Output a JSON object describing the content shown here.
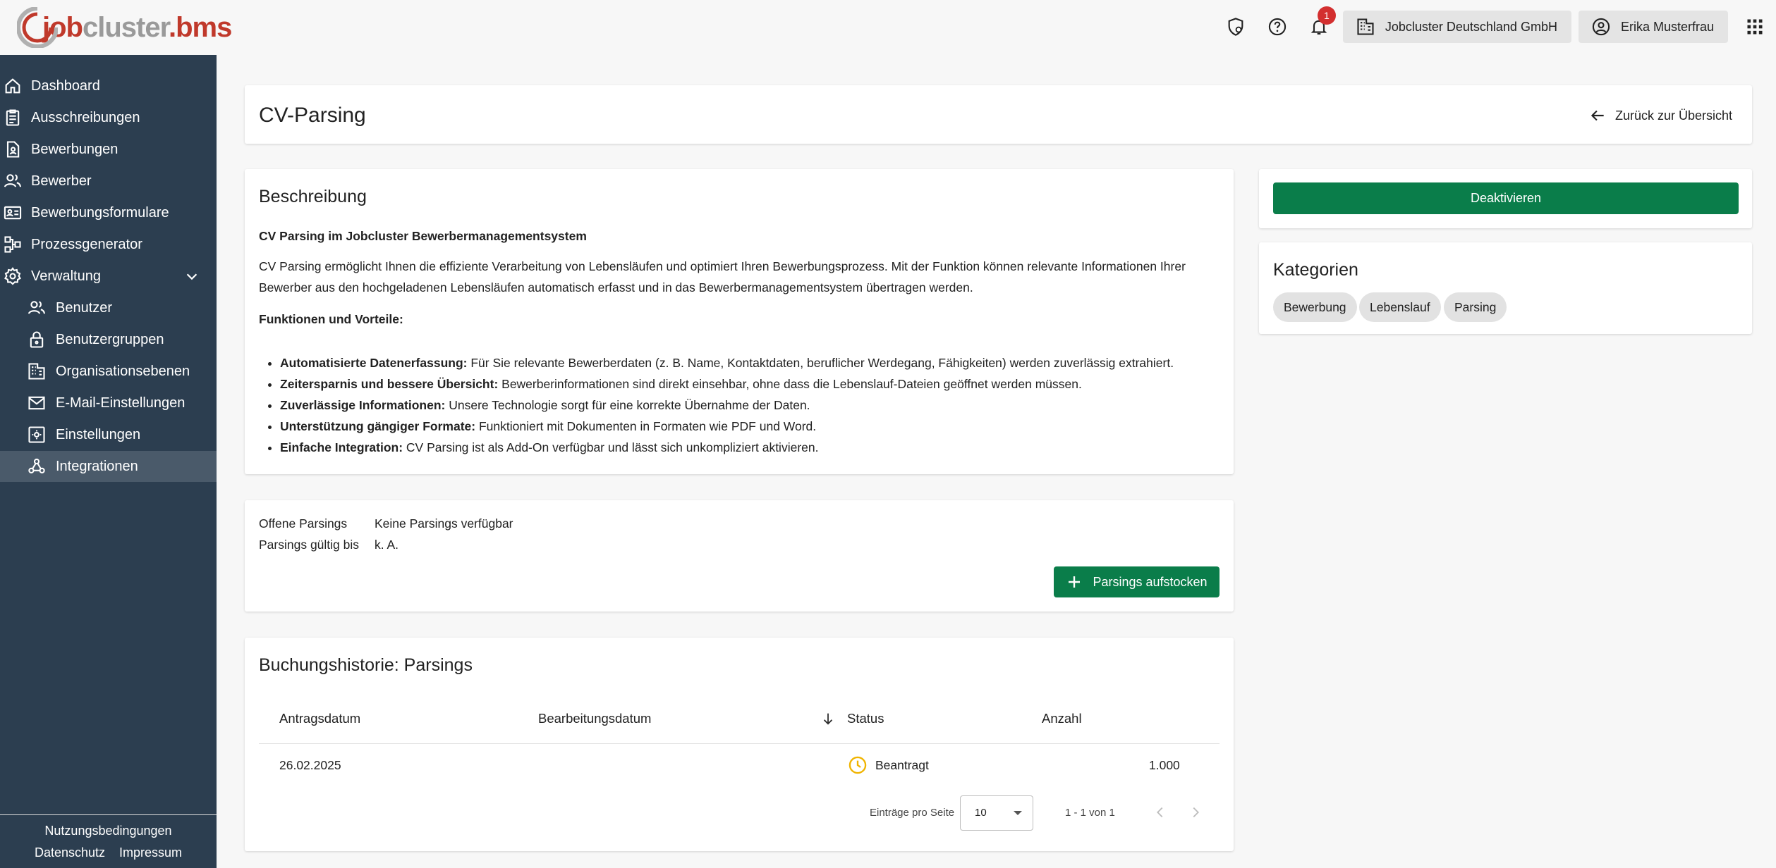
{
  "brand": {
    "logo_job": "job",
    "logo_cluster": "cluster",
    "logo_bms": ".bms"
  },
  "topbar": {
    "notification_count": "1",
    "company": "Jobcluster Deutschland GmbH",
    "user": "Erika Musterfrau"
  },
  "sidebar": {
    "items": [
      {
        "label": "Dashboard",
        "icon": "home-icon"
      },
      {
        "label": "Ausschreibungen",
        "icon": "clipboard-icon"
      },
      {
        "label": "Bewerbungen",
        "icon": "document-user-icon"
      },
      {
        "label": "Bewerber",
        "icon": "users-icon"
      },
      {
        "label": "Bewerbungsformulare",
        "icon": "id-card-icon"
      },
      {
        "label": "Prozessgenerator",
        "icon": "flowchart-icon"
      },
      {
        "label": "Verwaltung",
        "icon": "gear-icon"
      },
      {
        "label": "Benutzer",
        "icon": "users-icon"
      },
      {
        "label": "Benutzergruppen",
        "icon": "lock-icon"
      },
      {
        "label": "Organisationsebenen",
        "icon": "building-icon"
      },
      {
        "label": "E-Mail-Einstellungen",
        "icon": "mail-icon"
      },
      {
        "label": "Einstellungen",
        "icon": "settings-box-icon"
      },
      {
        "label": "Integrationen",
        "icon": "webhook-icon"
      }
    ],
    "footer": {
      "terms": "Nutzungsbedingungen",
      "privacy": "Datenschutz",
      "imprint": "Impressum"
    }
  },
  "header": {
    "title": "CV-Parsing",
    "back": "Zurück zur Übersicht"
  },
  "description": {
    "heading": "Beschreibung",
    "subheading": "CV Parsing im Jobcluster Bewerbermanagementsystem",
    "paragraph_line1": "CV Parsing ermöglicht Ihnen die effiziente Verarbeitung von Lebensläufen und optimiert Ihren Bewerbungsprozess. Mit der Funktion können relevante Informationen Ihrer",
    "paragraph_line2": "Bewerber aus den hochgeladenen Lebensläufen automatisch erfasst und in das Bewerbermanagementsystem übertragen werden.",
    "features_heading": "Funktionen und Vorteile:",
    "features": [
      {
        "title": "Automatisierte Datenerfassung:",
        "text": " Für Sie relevante Bewerberdaten (z. B. Name, Kontaktdaten, beruflicher Werdegang, Fähigkeiten) werden zuverlässig extrahiert."
      },
      {
        "title": "Zeitersparnis und bessere Übersicht:",
        "text": " Bewerberinformationen sind direkt einsehbar, ohne dass die Lebenslauf-Dateien geöffnet werden müssen."
      },
      {
        "title": "Zuverlässige Informationen:",
        "text": " Unsere Technologie sorgt für eine korrekte Übernahme der Daten."
      },
      {
        "title": "Unterstützung gängiger Formate:",
        "text": " Funktioniert mit Dokumenten in Formaten wie PDF und Word."
      },
      {
        "title": "Einfache Integration:",
        "text": " CV Parsing ist als Add-On verfügbar und lässt sich unkompliziert aktivieren."
      }
    ]
  },
  "parsings": {
    "open_label": "Offene Parsings",
    "open_value": "Keine Parsings verfügbar",
    "valid_label": "Parsings gültig bis",
    "valid_value": "k. A.",
    "topup_button": "Parsings aufstocken"
  },
  "actions": {
    "deactivate": "Deaktivieren"
  },
  "categories": {
    "heading": "Kategorien",
    "chips": [
      "Bewerbung",
      "Lebenslauf",
      "Parsing"
    ]
  },
  "history": {
    "heading": "Buchungshistorie: Parsings",
    "columns": [
      "Antragsdatum",
      "Bearbeitungsdatum",
      "Status",
      "Anzahl"
    ],
    "rows": [
      {
        "antragsdatum": "26.02.2025",
        "bearbeitungsdatum": "",
        "status": "Beantragt",
        "anzahl": "1.000"
      }
    ],
    "per_page_label": "Einträge pro Seite",
    "per_page_value": "10",
    "range": "1 - 1 von 1"
  },
  "colors": {
    "sidebar": "#2c3e50",
    "primary": "#0a7d4a",
    "badge": "#d32f2f",
    "pending": "#f0b400"
  }
}
